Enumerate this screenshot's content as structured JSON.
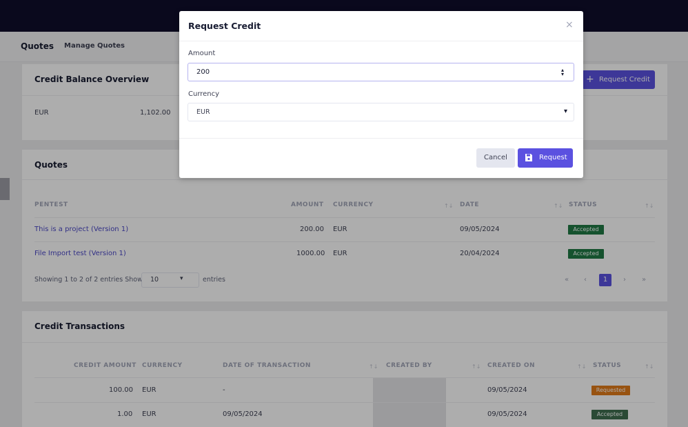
{
  "header": {
    "title": "Quotes",
    "breadcrumb": "Manage Quotes"
  },
  "balance": {
    "title": "Credit Balance Overview",
    "button": "Request Credit",
    "currency": "EUR",
    "amount": "1,102.00"
  },
  "quotes": {
    "title": "Quotes",
    "columns": [
      "PENTEST",
      "AMOUNT",
      "CURRENCY",
      "DATE",
      "STATUS"
    ],
    "rows": [
      {
        "pentest": "This is a project (Version 1)",
        "amount": "200.00",
        "currency": "EUR",
        "date": "09/05/2024",
        "status": "Accepted"
      },
      {
        "pentest": "File Import test (Version 1)",
        "amount": "1000.00",
        "currency": "EUR",
        "date": "20/04/2024",
        "status": "Accepted"
      }
    ],
    "info": "Showing 1 to 2 of 2 entries",
    "show_label": "Show",
    "show_value": "10",
    "entries_label": "entries",
    "pagination": {
      "first": "«",
      "prev": "‹",
      "current": "1",
      "next": "›",
      "last": "»"
    }
  },
  "transactions": {
    "title": "Credit Transactions",
    "columns": [
      "CREDIT AMOUNT",
      "CURRENCY",
      "DATE OF TRANSACTION",
      "CREATED BY",
      "CREATED ON",
      "STATUS"
    ],
    "rows": [
      {
        "amount": "100.00",
        "currency": "EUR",
        "date": "-",
        "created_on": "09/05/2024",
        "status": "Requested"
      },
      {
        "amount": "1.00",
        "currency": "EUR",
        "date": "09/05/2024",
        "created_on": "09/05/2024",
        "status": "Accepted"
      }
    ]
  },
  "modal": {
    "title": "Request Credit",
    "close": "×",
    "amount_label": "Amount",
    "amount_value": "200",
    "currency_label": "Currency",
    "currency_value": "EUR",
    "cancel": "Cancel",
    "submit": "Request"
  },
  "colors": {
    "accent": "#5b51e0",
    "topbar": "#0f0e2c",
    "accepted": "#1f7a45",
    "requested": "#e07b1a"
  },
  "icons": {
    "save": "floppy-disk-icon",
    "plus": "plus-icon",
    "chevron": "chevron-down-icon",
    "close": "close-icon",
    "sort": "sort-icon"
  }
}
